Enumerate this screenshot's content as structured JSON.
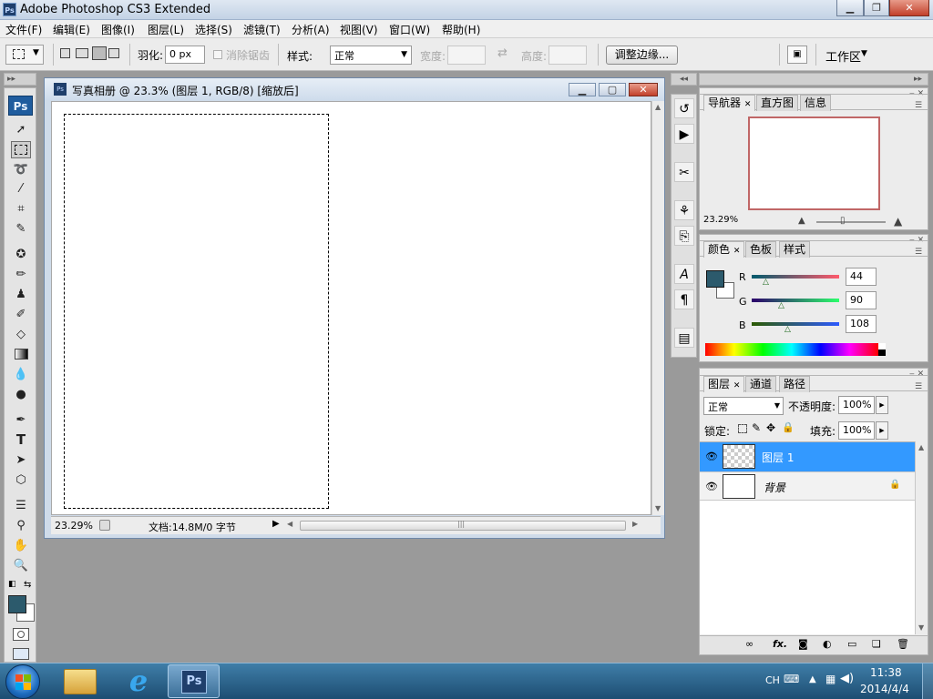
{
  "window": {
    "title": "Adobe Photoshop CS3 Extended",
    "app_icon": "Ps"
  },
  "menu": [
    "文件(F)",
    "编辑(E)",
    "图像(I)",
    "图层(L)",
    "选择(S)",
    "滤镜(T)",
    "分析(A)",
    "视图(V)",
    "窗口(W)",
    "帮助(H)"
  ],
  "options": {
    "feather_label": "羽化:",
    "feather_value": "0 px",
    "antialias_label": "消除锯齿",
    "style_label": "样式:",
    "style_value": "正常",
    "width_label": "宽度:",
    "height_label": "高度:",
    "refine_button": "调整边缘...",
    "workspace_label": "工作区"
  },
  "document": {
    "title": "写真相册 @ 23.3% (图层 1, RGB/8) [缩放后]",
    "zoom": "23.29%",
    "status": "文档:14.8M/0 字节"
  },
  "navigator": {
    "tabs": [
      "导航器",
      "直方图",
      "信息"
    ],
    "zoom": "23.29%"
  },
  "color": {
    "tabs": [
      "颜色",
      "色板",
      "样式"
    ],
    "r_label": "R",
    "r_value": "44",
    "g_label": "G",
    "g_value": "90",
    "b_label": "B",
    "b_value": "108",
    "foreground": "#2c5a6c"
  },
  "layers": {
    "tabs": [
      "图层",
      "通道",
      "路径"
    ],
    "blend": "正常",
    "opacity_label": "不透明度:",
    "opacity": "100%",
    "lock_label": "锁定:",
    "fill_label": "填充:",
    "fill": "100%",
    "items": [
      {
        "name": "图层 1",
        "selected": true
      },
      {
        "name": "背景",
        "selected": false
      }
    ]
  },
  "taskbar": {
    "lang": "CH",
    "time": "11:38",
    "date": "2014/4/4",
    "ps_label": "Ps"
  }
}
